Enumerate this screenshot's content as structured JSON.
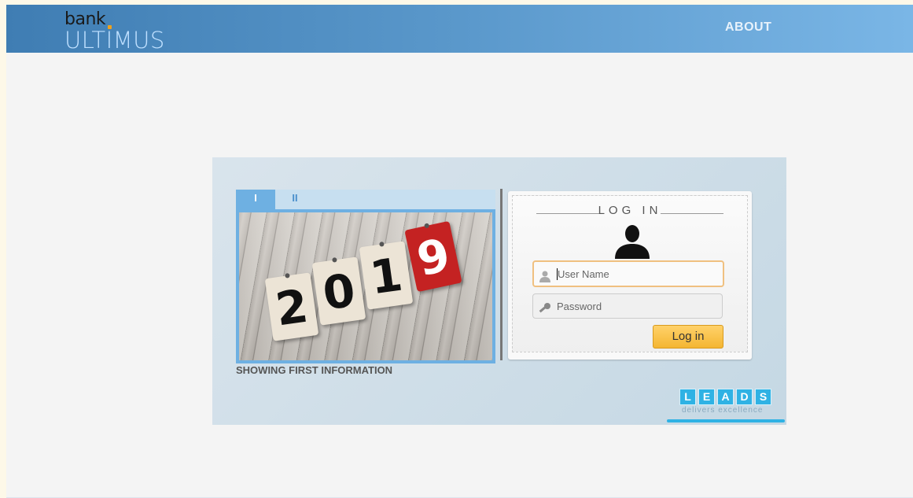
{
  "header": {
    "logo_line1": "bank",
    "logo_line2": "ULTIMUS",
    "nav": {
      "about": "ABOUT"
    },
    "colors": {
      "header_start": "#3f7db3",
      "header_end": "#7ab6e6",
      "logo_dot": "#f0a21c"
    }
  },
  "slider": {
    "tabs": [
      {
        "label": "I"
      },
      {
        "label": "II"
      }
    ],
    "active_tab": "I",
    "slide_image": {
      "digits": [
        "2",
        "0",
        "1",
        "9"
      ]
    },
    "caption": "SHOWING FIRST INFORMATION"
  },
  "login": {
    "title": "LOG IN",
    "username": {
      "placeholder": "User Name",
      "value": ""
    },
    "password": {
      "placeholder": "Password",
      "value": ""
    },
    "submit_label": "Log in",
    "icons": {
      "avatar": "user-silhouette-icon",
      "username": "user-icon",
      "password": "key-icon"
    }
  },
  "badge": {
    "letters": [
      "L",
      "E",
      "A",
      "D",
      "S"
    ],
    "tagline": "delivers excellence",
    "color": "#2fb2e4"
  }
}
